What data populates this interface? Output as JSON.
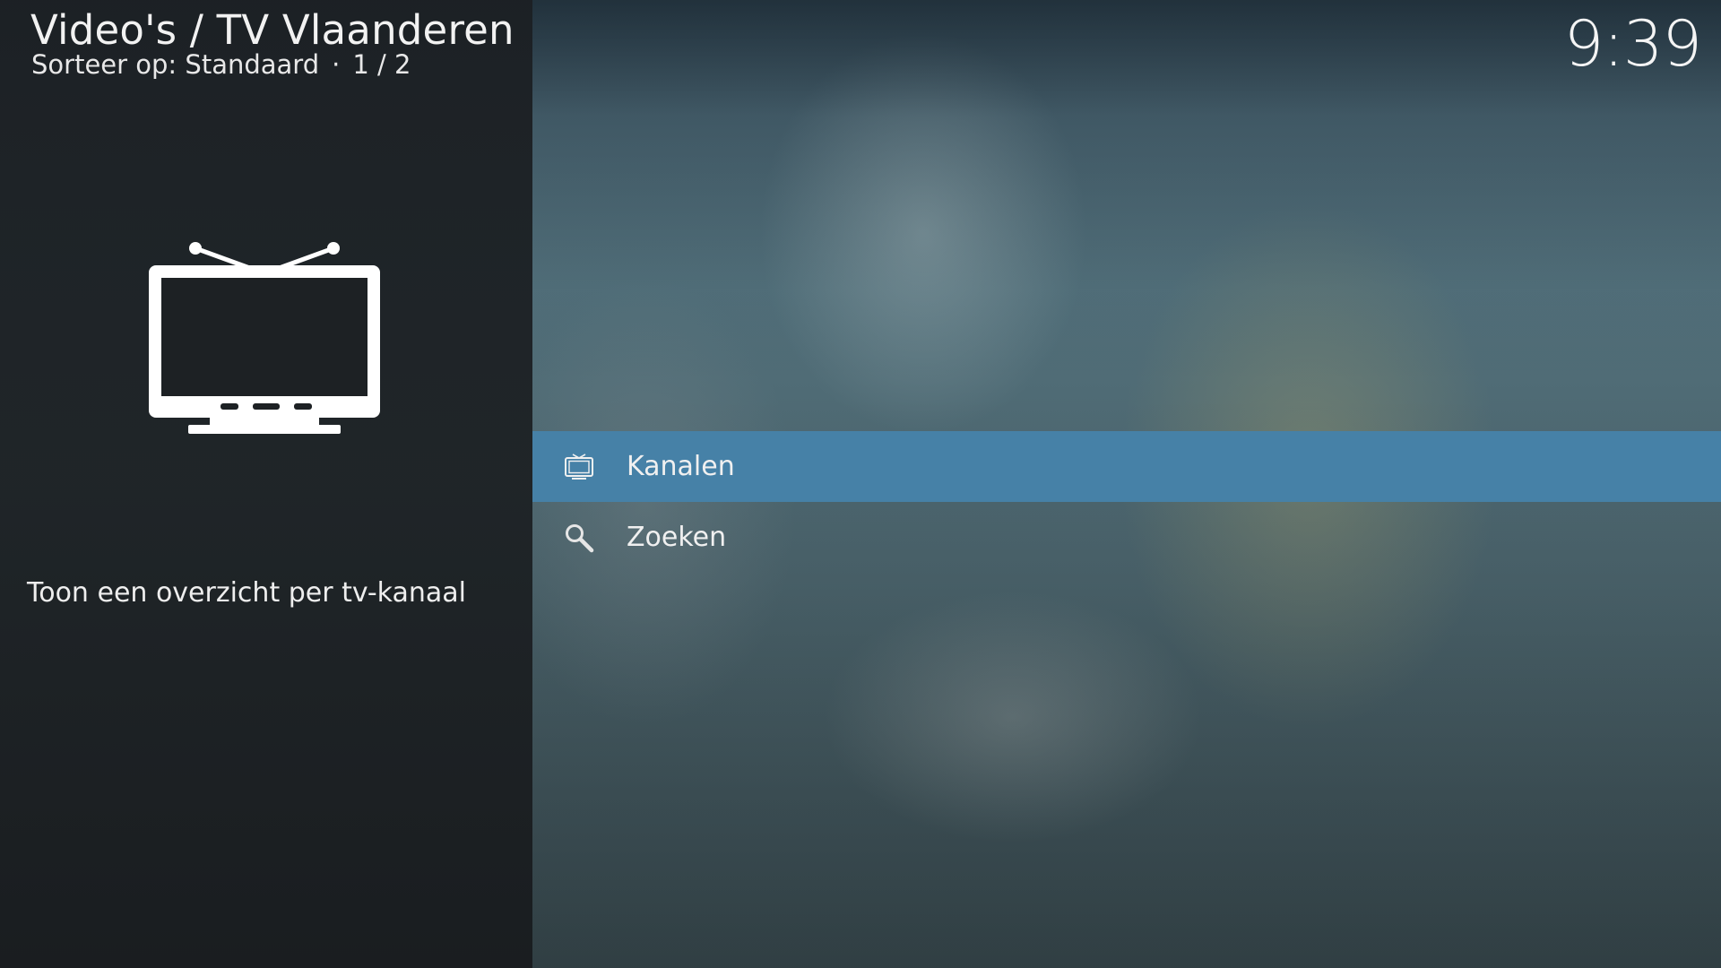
{
  "header": {
    "title": "Video's / TV Vlaanderen",
    "sort_label": "Sorteer op: Standaard",
    "separator": "·",
    "page_indicator": "1 / 2"
  },
  "clock": {
    "time": "9:39"
  },
  "info_panel": {
    "icon": "tv-icon",
    "description": "Toon een overzicht per tv-kanaal"
  },
  "list": {
    "items": [
      {
        "label": "Kanalen",
        "icon": "tv-icon",
        "focused": true
      },
      {
        "label": "Zoeken",
        "icon": "search-icon",
        "focused": false
      }
    ]
  },
  "colors": {
    "focus": "#4681a7",
    "panel": "#1c2024",
    "text": "#f0f0f0"
  }
}
